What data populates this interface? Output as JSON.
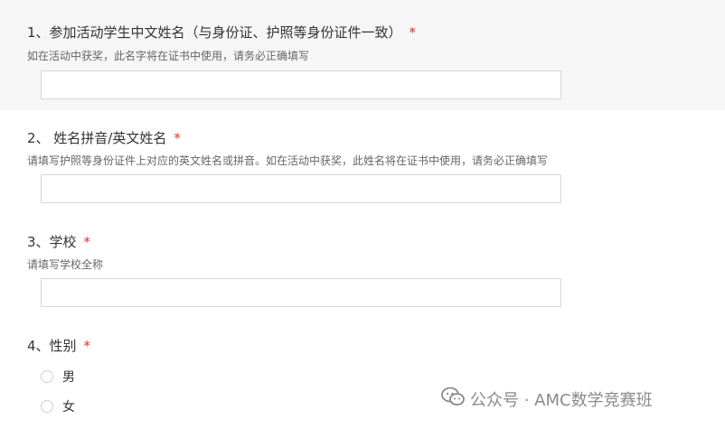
{
  "questions": [
    {
      "title": "1、参加活动学生中文姓名（与身份证、护照等身份证件一致）",
      "required_mark": "*",
      "hint": "如在活动中获奖，此名字将在证书中使用，请务必正确填写",
      "value": "",
      "placeholder": ""
    },
    {
      "title": "2、 姓名拼音/英文姓名",
      "required_mark": "*",
      "hint": "请填写护照等身份证件上对应的英文姓名或拼音。如在活动中获奖，此姓名将在证书中使用，请务必正确填写",
      "value": "",
      "placeholder": ""
    },
    {
      "title": "3、学校",
      "required_mark": "*",
      "hint": "请填写学校全称",
      "value": "",
      "placeholder": ""
    },
    {
      "title": "4、性别",
      "required_mark": "*",
      "options": [
        "男",
        "女"
      ]
    }
  ],
  "watermark": {
    "text": "公众号 · AMC数学竞赛班",
    "icon": "wechat-icon"
  },
  "colors": {
    "required": "#e0312b",
    "highlight_bg": "#f6f6f6",
    "border": "#d6d6d6"
  }
}
